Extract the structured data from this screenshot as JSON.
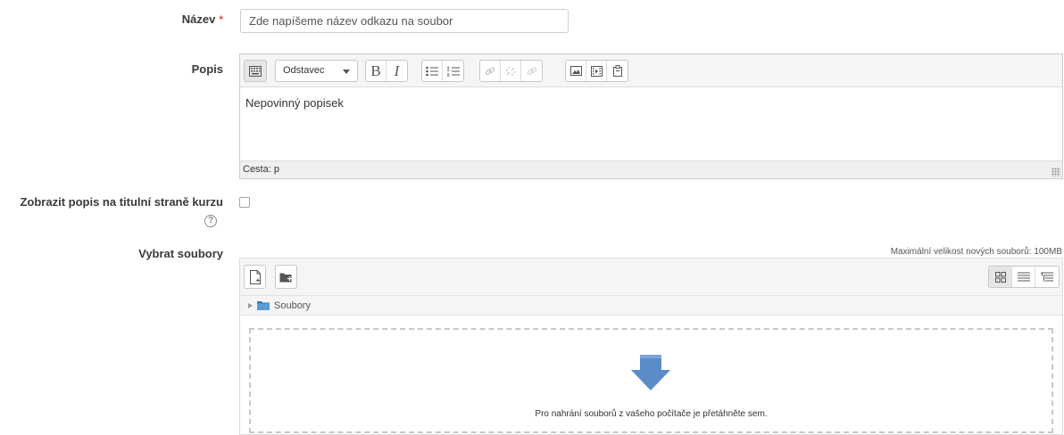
{
  "form": {
    "name_label": "Název",
    "required_mark": "*",
    "name_value": "Zde napíšeme název odkazu na soubor",
    "description_label": "Popis",
    "show_description_label": "Zobrazit popis na titulní straně kurzu",
    "select_files_label": "Vybrat soubory"
  },
  "editor": {
    "paragraph_format": "Odstavec",
    "bold_label": "B",
    "italic_label": "I",
    "content": "Nepovinný popisek",
    "status_path": "Cesta: p"
  },
  "filemanager": {
    "max_size_text": "Maximální velikost nových souborů: 100MB",
    "breadcrumb_folder": "Soubory",
    "drop_text": "Pro nahrání souborů z vašeho počítače je přetáhněte sem."
  },
  "colors": {
    "required": "#d9534f",
    "folder": "#3d7bb0",
    "arrow": "#5b8cc8"
  }
}
